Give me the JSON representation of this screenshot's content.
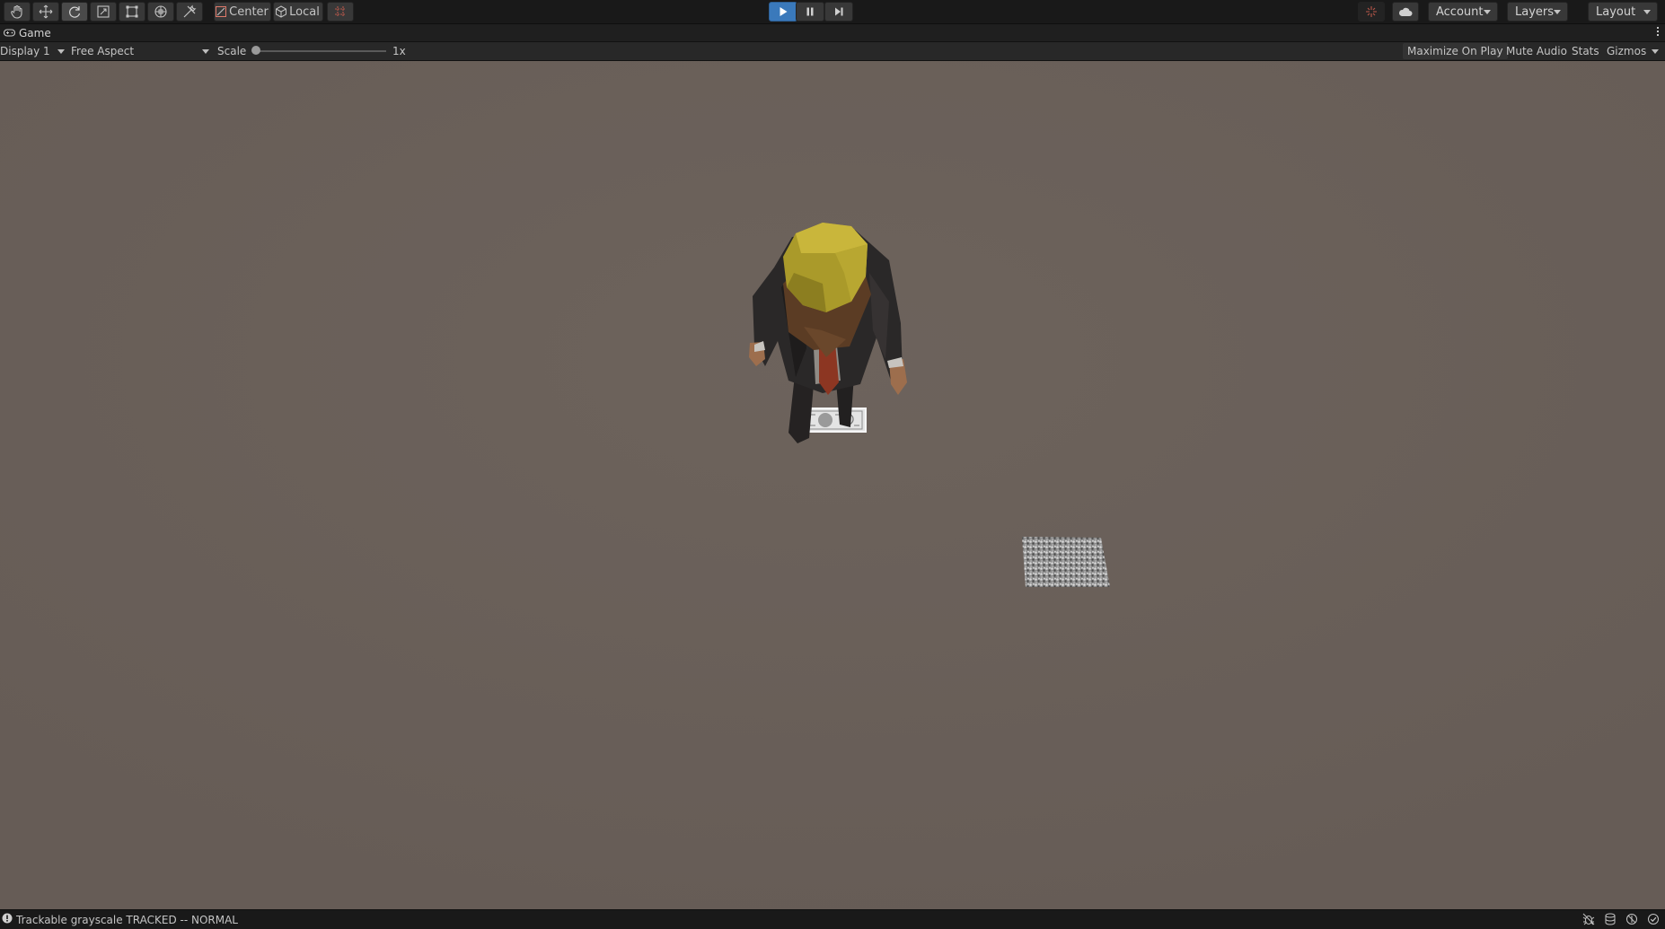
{
  "toolbar": {
    "tools": [
      {
        "name": "hand-tool",
        "icon": "hand-icon"
      },
      {
        "name": "move-tool",
        "icon": "move-arrows-icon"
      },
      {
        "name": "rotate-tool",
        "icon": "rotate-icon"
      },
      {
        "name": "scale-tool",
        "icon": "scale-icon"
      },
      {
        "name": "rect-tool",
        "icon": "rect-transform-icon"
      },
      {
        "name": "transform-tool",
        "icon": "transform-icon"
      },
      {
        "name": "custom-tool",
        "icon": "tools-icon"
      }
    ],
    "pivot_label": "Center",
    "space_label": "Local",
    "snap_icon": "grid-snap-icon",
    "account_label": "Account",
    "layers_label": "Layers",
    "layout_label": "Layout",
    "accent_color": "#3a79bb"
  },
  "tab": {
    "title": "Game",
    "icon": "gamepad-icon"
  },
  "gamebar": {
    "display": "Display 1",
    "aspect": "Free Aspect",
    "scale_label": "Scale",
    "scale_value": "1x",
    "maximize_on_play": "Maximize On Play",
    "mute_audio": "Mute Audio",
    "stats": "Stats",
    "gizmos": "Gizmos"
  },
  "viewport": {
    "background": "#6a605a"
  },
  "status": {
    "message": "Trackable grayscale TRACKED -- NORMAL",
    "icon": "info-icon"
  }
}
